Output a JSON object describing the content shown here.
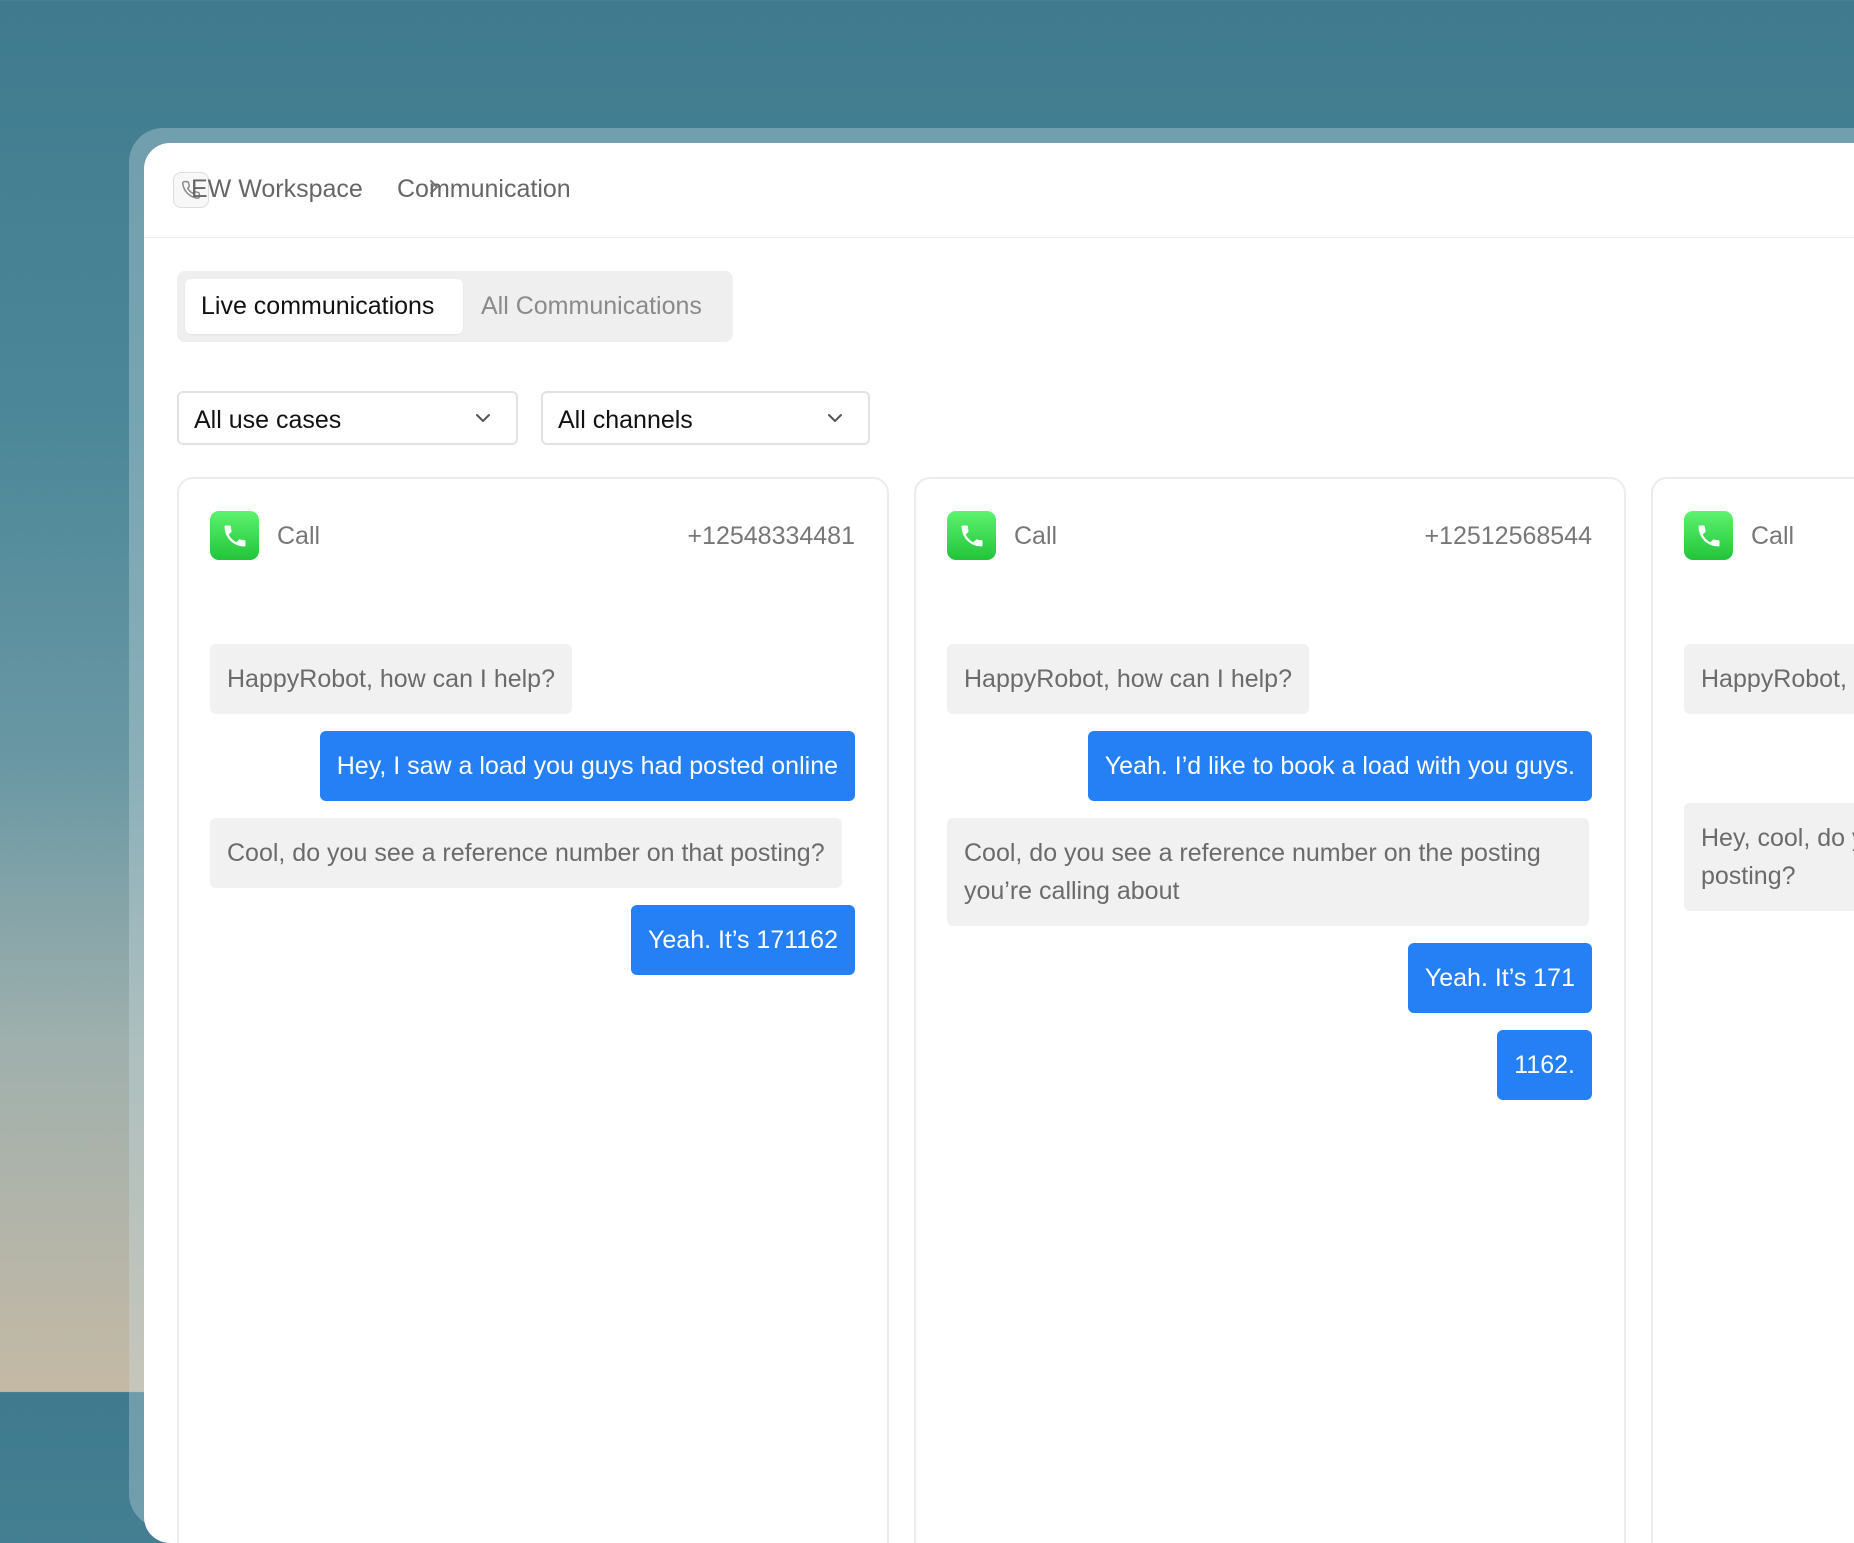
{
  "breadcrumb": {
    "workspace": "EW Workspace",
    "page": "Communication"
  },
  "tabs": [
    {
      "label": "Live communications",
      "active": true
    },
    {
      "label": "All Communications",
      "active": false
    }
  ],
  "filters": {
    "use_cases": "All use cases",
    "channels": "All channels"
  },
  "colors": {
    "user_bubble": "#2680f5",
    "bot_bubble": "#f1f1f1",
    "call_icon": "#2bcb44"
  },
  "cards": [
    {
      "type_label": "Call",
      "number": "+12548334481",
      "messages": [
        {
          "from": "bot",
          "text": "HappyRobot, how can I help?"
        },
        {
          "from": "user",
          "text": "Hey, I saw a load you guys had posted online"
        },
        {
          "from": "bot",
          "text": "Cool, do you see a reference number on that posting?"
        },
        {
          "from": "user",
          "text": "Yeah. It’s 171162"
        }
      ]
    },
    {
      "type_label": "Call",
      "number": "+12512568544",
      "messages": [
        {
          "from": "bot",
          "text": "HappyRobot, how can I help?"
        },
        {
          "from": "user",
          "text": "Yeah. I’d like to book a load with you guys."
        },
        {
          "from": "bot",
          "text": "Cool, do you see a reference number on the posting you’re calling about"
        },
        {
          "from": "user",
          "text": "Yeah. It’s 171"
        },
        {
          "from": "user",
          "text": "1162."
        }
      ]
    },
    {
      "type_label": "Call",
      "number": "",
      "messages": [
        {
          "from": "bot",
          "text": "HappyRobot, how can I help?"
        },
        {
          "from": "bot",
          "text": "Hey, cool, do you see a reference number on that posting?"
        }
      ]
    }
  ]
}
